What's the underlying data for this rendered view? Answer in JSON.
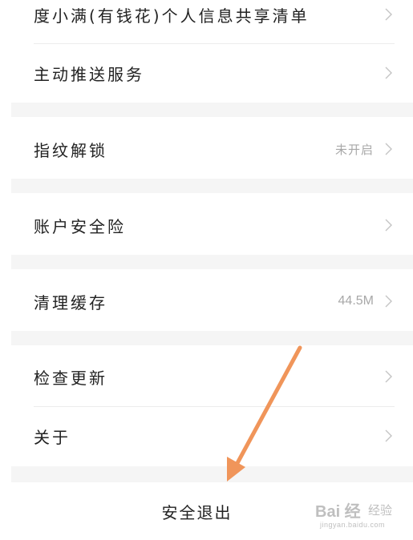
{
  "settings": {
    "items": [
      {
        "label": "度小满(有钱花)个人信息共享清单",
        "value": ""
      },
      {
        "label": "主动推送服务",
        "value": ""
      },
      {
        "label": "指纹解锁",
        "value": "未开启"
      },
      {
        "label": "账户安全险",
        "value": ""
      },
      {
        "label": "清理缓存",
        "value": "44.5M"
      },
      {
        "label": "检查更新",
        "value": ""
      },
      {
        "label": "关于",
        "value": ""
      }
    ],
    "logout_label": "安全退出"
  },
  "annotation": {
    "arrow_color": "#f0955a"
  },
  "watermark": {
    "main": "Bai 经",
    "sub": "经验",
    "url": "jingyan.baidu.com"
  },
  "colors": {
    "background": "#ffffff",
    "section_gap": "#f5f5f5",
    "text": "#222222",
    "muted": "#a8a8a8"
  }
}
